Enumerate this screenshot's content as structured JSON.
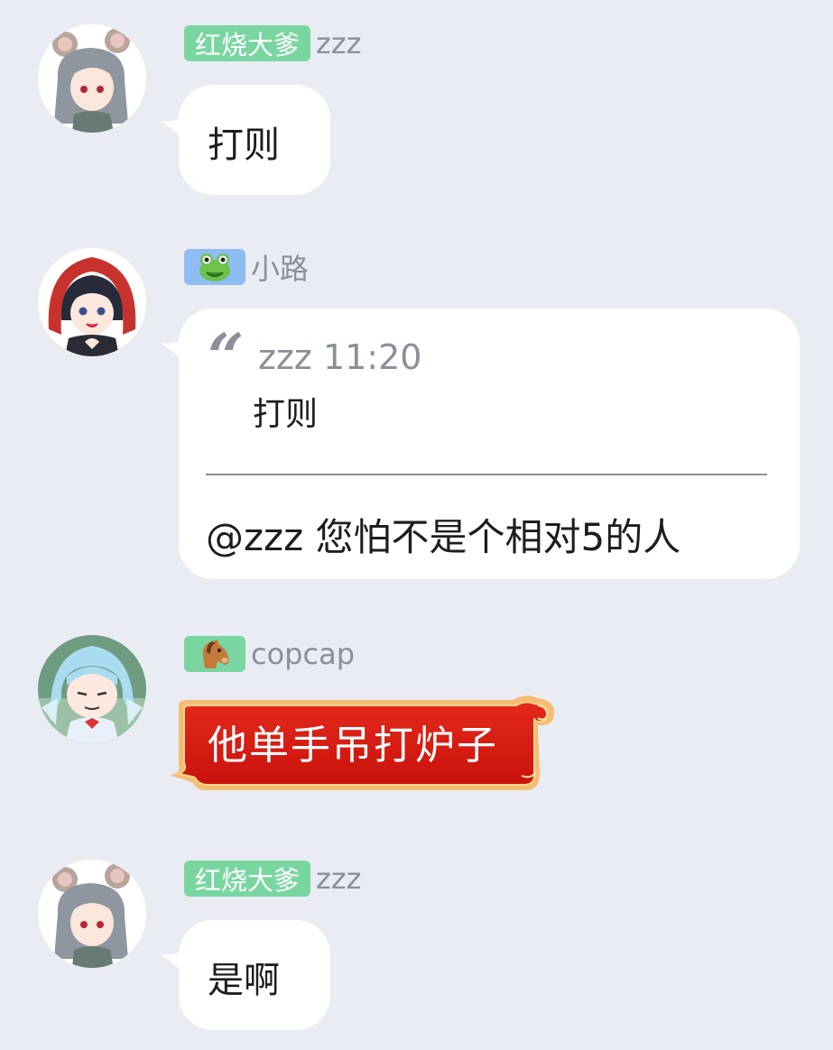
{
  "messages": [
    {
      "badge": "红烧大爹",
      "username": "zzz",
      "avatar": "avatar-mouse-girl",
      "text": "打则"
    },
    {
      "badge_icon": "frog-icon",
      "username": "小路",
      "avatar": "avatar-red-hood-girl",
      "quote": {
        "author": "zzz",
        "time": "11:20",
        "text": "打则"
      },
      "text": "@zzz 您怕不是个相对5的人"
    },
    {
      "badge_icon": "horse-icon",
      "username": "copcap",
      "avatar": "avatar-ice-fairy",
      "text": "他单手吊打炉子"
    },
    {
      "badge": "红烧大爹",
      "username": "zzz",
      "avatar": "avatar-mouse-girl",
      "text": "是啊"
    }
  ],
  "colors": {
    "background": "#e9ecf3",
    "badge_green": "#7ad6a1",
    "badge_blue": "#8fbdf3",
    "badge_horse": "#7ad6a1",
    "username": "#8a8f99",
    "red_bubble": "#d8170f"
  }
}
